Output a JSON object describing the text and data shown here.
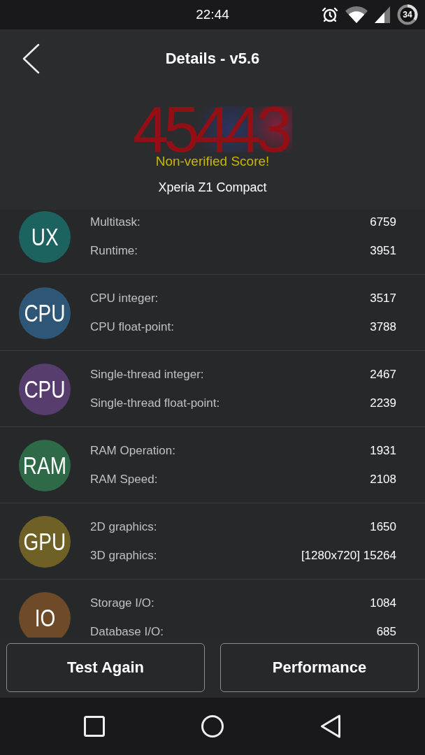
{
  "status_bar": {
    "time": "22:44",
    "battery": "34"
  },
  "header": {
    "title": "Details - v5.6"
  },
  "score": {
    "value": "45443",
    "note": "Non-verified Score!",
    "device": "Xperia Z1 Compact"
  },
  "categories": [
    {
      "badge": "UX",
      "color": "#1c6360",
      "metrics": [
        {
          "label": "Multitask:",
          "value": "6759"
        },
        {
          "label": "Runtime:",
          "value": "3951"
        }
      ]
    },
    {
      "badge": "CPU",
      "color": "#2e5777",
      "metrics": [
        {
          "label": "CPU integer:",
          "value": "3517"
        },
        {
          "label": "CPU float-point:",
          "value": "3788"
        }
      ]
    },
    {
      "badge": "CPU",
      "color": "#573c6e",
      "metrics": [
        {
          "label": "Single-thread integer:",
          "value": "2467"
        },
        {
          "label": "Single-thread float-point:",
          "value": "2239"
        }
      ]
    },
    {
      "badge": "RAM",
      "color": "#2e6a47",
      "metrics": [
        {
          "label": "RAM Operation:",
          "value": "1931"
        },
        {
          "label": "RAM Speed:",
          "value": "2108"
        }
      ]
    },
    {
      "badge": "GPU",
      "color": "#6f6126",
      "metrics": [
        {
          "label": "2D graphics:",
          "value": "1650"
        },
        {
          "label": "3D graphics:",
          "value": "[1280x720] 15264"
        }
      ]
    },
    {
      "badge": "IO",
      "color": "#6e4a28",
      "metrics": [
        {
          "label": "Storage I/O:",
          "value": "1084"
        },
        {
          "label": "Database I/O:",
          "value": "685"
        }
      ]
    }
  ],
  "buttons": [
    "Test Again",
    "Performance"
  ]
}
